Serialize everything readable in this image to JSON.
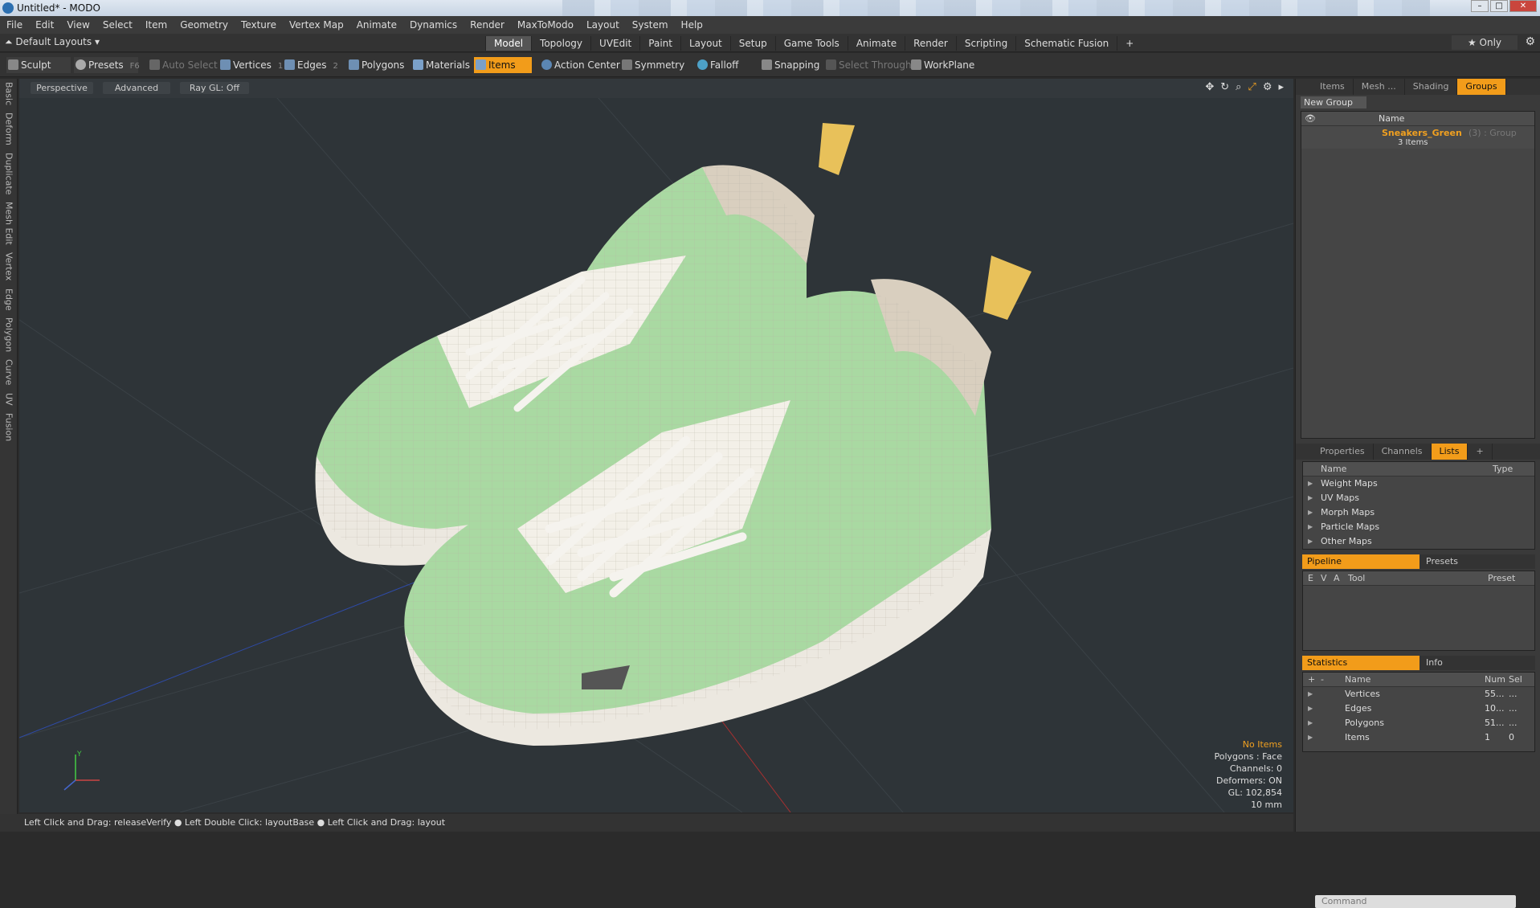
{
  "window": {
    "title": "Untitled* - MODO"
  },
  "menu": [
    "File",
    "Edit",
    "View",
    "Select",
    "Item",
    "Geometry",
    "Texture",
    "Vertex Map",
    "Animate",
    "Dynamics",
    "Render",
    "MaxToModo",
    "Layout",
    "System",
    "Help"
  ],
  "layouts_label": "Default Layouts ▾",
  "tabs": [
    "Model",
    "Topology",
    "UVEdit",
    "Paint",
    "Layout",
    "Setup",
    "Game Tools",
    "Animate",
    "Render",
    "Scripting",
    "Schematic Fusion",
    "+"
  ],
  "active_tab": "Model",
  "only_label": "★ Only",
  "toolbar": {
    "sculpt": "Sculpt",
    "presets": "Presets",
    "presets_key": "F6",
    "auto_select": "Auto Select",
    "vertices": "Vertices",
    "vertices_key": "1",
    "edges": "Edges",
    "edges_key": "2",
    "polygons": "Polygons",
    "materials": "Materials",
    "items": "Items",
    "action_center": "Action Center",
    "symmetry": "Symmetry",
    "falloff": "Falloff",
    "snapping": "Snapping",
    "select_through": "Select Through",
    "workplane": "WorkPlane"
  },
  "left_tabs": [
    "Basic",
    "Deform",
    "Duplicate",
    "Mesh Edit",
    "Vertex",
    "Edge",
    "Polygon",
    "Curve",
    "UV",
    "Fusion"
  ],
  "viewport": {
    "perspective": "Perspective",
    "advanced": "Advanced",
    "raygl": "Ray GL: Off",
    "stats": {
      "no_items": "No Items",
      "polygons": "Polygons : Face",
      "channels": "Channels: 0",
      "deformers": "Deformers: ON",
      "gl": "GL: 102,854",
      "scale": "10 mm"
    }
  },
  "status": "Left Click and Drag: releaseVerify ● Left Double Click: layoutBase ● Left Click and Drag: layout",
  "right": {
    "top_tabs": [
      "Items",
      "Mesh ...",
      "Shading",
      "Groups"
    ],
    "active_top_tab": "Groups",
    "new_group": "New Group",
    "name_header": "Name",
    "group_name": "Sneakers_Green",
    "group_suffix": "(3) : Group",
    "group_count": "3 Items",
    "mid_tabs": [
      "Properties",
      "Channels",
      "Lists",
      "+"
    ],
    "active_mid_tab": "Lists",
    "lists_header_name": "Name",
    "lists_header_type": "Type",
    "lists": [
      "Weight Maps",
      "UV Maps",
      "Morph Maps",
      "Particle Maps",
      "Other Maps"
    ],
    "pipeline_tab": "Pipeline",
    "presets_tab": "Presets",
    "pipeline_cols": [
      "E",
      "V",
      "A",
      "Tool",
      "Preset"
    ],
    "statistics_tab": "Statistics",
    "info_tab": "Info",
    "stats_cols": [
      "Name",
      "Num",
      "Sel"
    ],
    "stats_rows": [
      {
        "name": "Vertices",
        "num": "55...",
        "sel": "..."
      },
      {
        "name": "Edges",
        "num": "10...",
        "sel": "..."
      },
      {
        "name": "Polygons",
        "num": "51...",
        "sel": "..."
      },
      {
        "name": "Items",
        "num": "1",
        "sel": "0"
      }
    ],
    "command": "Command"
  }
}
